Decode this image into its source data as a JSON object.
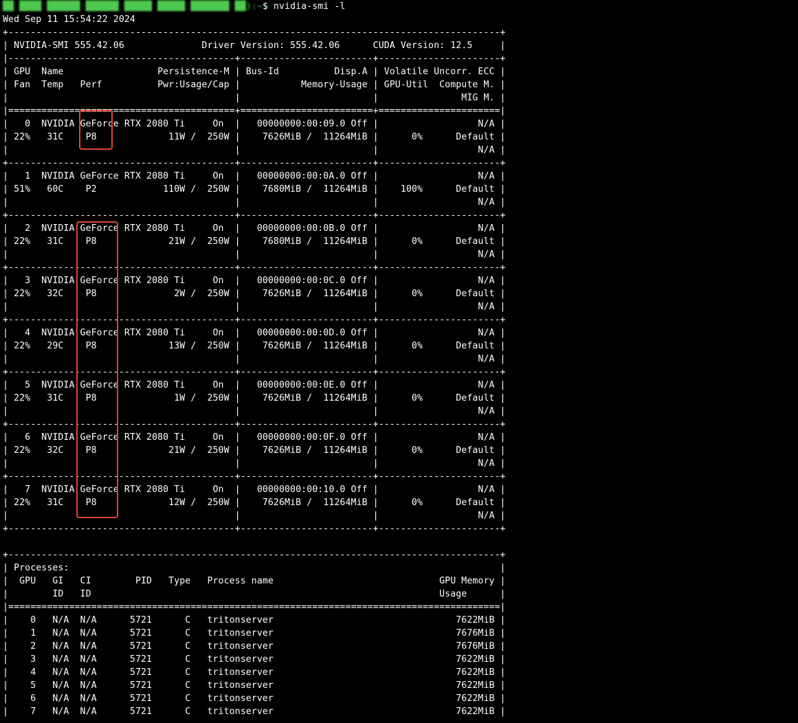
{
  "prompt": {
    "prefix": "██ ████ ██████ ██████ █████ █████ ███████ ██):~",
    "symbol": "$ ",
    "command": "nvidia-smi -l"
  },
  "output_lines": [
    "Wed Sep 11 15:54:22 2024",
    "+-----------------------------------------------------------------------------------------+",
    "| NVIDIA-SMI 555.42.06              Driver Version: 555.42.06      CUDA Version: 12.5     |",
    "|-----------------------------------------+------------------------+----------------------+",
    "| GPU  Name                 Persistence-M | Bus-Id          Disp.A | Volatile Uncorr. ECC |",
    "| Fan  Temp   Perf          Pwr:Usage/Cap |           Memory-Usage | GPU-Util  Compute M. |",
    "|                                         |                        |               MIG M. |",
    "|=========================================+========================+======================|",
    "|   0  NVIDIA GeForce RTX 2080 Ti     On  |   00000000:00:09.0 Off |                  N/A |",
    "| 22%   31C    P8             11W /  250W |    7626MiB /  11264MiB |      0%      Default |",
    "|                                         |                        |                  N/A |",
    "+-----------------------------------------+------------------------+----------------------+",
    "|   1  NVIDIA GeForce RTX 2080 Ti     On  |   00000000:00:0A.0 Off |                  N/A |",
    "| 51%   60C    P2            110W /  250W |    7680MiB /  11264MiB |    100%      Default |",
    "|                                         |                        |                  N/A |",
    "+-----------------------------------------+------------------------+----------------------+",
    "|   2  NVIDIA GeForce RTX 2080 Ti     On  |   00000000:00:0B.0 Off |                  N/A |",
    "| 22%   31C    P8             21W /  250W |    7680MiB /  11264MiB |      0%      Default |",
    "|                                         |                        |                  N/A |",
    "+-----------------------------------------+------------------------+----------------------+",
    "|   3  NVIDIA GeForce RTX 2080 Ti     On  |   00000000:00:0C.0 Off |                  N/A |",
    "| 22%   32C    P8              2W /  250W |    7626MiB /  11264MiB |      0%      Default |",
    "|                                         |                        |                  N/A |",
    "+-----------------------------------------+------------------------+----------------------+",
    "|   4  NVIDIA GeForce RTX 2080 Ti     On  |   00000000:00:0D.0 Off |                  N/A |",
    "| 22%   29C    P8             13W /  250W |    7626MiB /  11264MiB |      0%      Default |",
    "|                                         |                        |                  N/A |",
    "+-----------------------------------------+------------------------+----------------------+",
    "|   5  NVIDIA GeForce RTX 2080 Ti     On  |   00000000:00:0E.0 Off |                  N/A |",
    "| 22%   31C    P8              1W /  250W |    7626MiB /  11264MiB |      0%      Default |",
    "|                                         |                        |                  N/A |",
    "+-----------------------------------------+------------------------+----------------------+",
    "|   6  NVIDIA GeForce RTX 2080 Ti     On  |   00000000:00:0F.0 Off |                  N/A |",
    "| 22%   32C    P8             21W /  250W |    7626MiB /  11264MiB |      0%      Default |",
    "|                                         |                        |                  N/A |",
    "+-----------------------------------------+------------------------+----------------------+",
    "|   7  NVIDIA GeForce RTX 2080 Ti     On  |   00000000:00:10.0 Off |                  N/A |",
    "| 22%   31C    P8             12W /  250W |    7626MiB /  11264MiB |      0%      Default |",
    "|                                         |                        |                  N/A |",
    "+-----------------------------------------+------------------------+----------------------+",
    "",
    "+-----------------------------------------------------------------------------------------+",
    "| Processes:                                                                              |",
    "|  GPU   GI   CI        PID   Type   Process name                              GPU Memory |",
    "|        ID   ID                                                               Usage      |",
    "|=========================================================================================|",
    "|    0   N/A  N/A      5721      C   tritonserver                                 7622MiB |",
    "|    1   N/A  N/A      5721      C   tritonserver                                 7676MiB |",
    "|    2   N/A  N/A      5721      C   tritonserver                                 7676MiB |",
    "|    3   N/A  N/A      5721      C   tritonserver                                 7622MiB |",
    "|    4   N/A  N/A      5721      C   tritonserver                                 7622MiB |",
    "|    5   N/A  N/A      5721      C   tritonserver                                 7622MiB |",
    "|    6   N/A  N/A      5721      C   tritonserver                                 7622MiB |",
    "|    7   N/A  N/A      5721      C   tritonserver                                 7622MiB |"
  ],
  "colors": {
    "background": "#000000",
    "text": "#ffffff",
    "prompt_user": "#4ec94e",
    "annotation_box": "#e0452f"
  }
}
